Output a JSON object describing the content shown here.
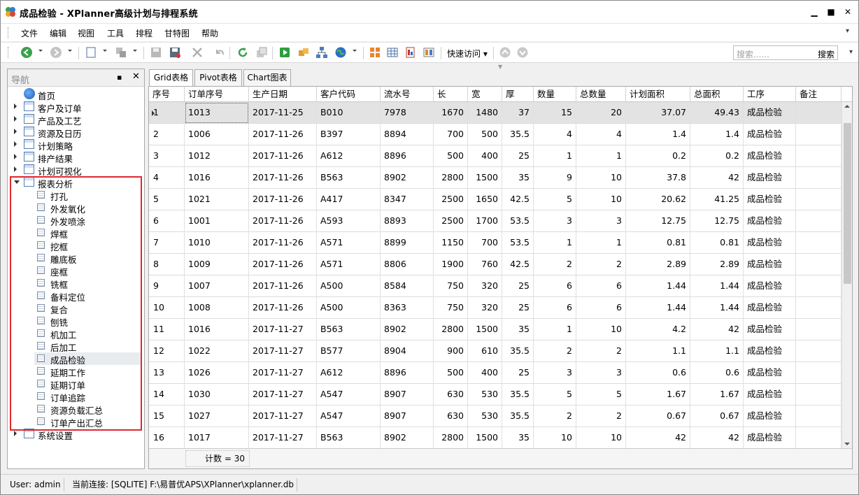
{
  "window": {
    "title": "成品检验 - XPlanner高级计划与排程系统",
    "minimize_glyph": "▁",
    "maximize_glyph": "■",
    "close_glyph": "✕"
  },
  "menu": [
    "文件",
    "编辑",
    "视图",
    "工具",
    "排程",
    "甘特图",
    "帮助"
  ],
  "toolbar": {
    "quick_access_label": "快速访问",
    "search_placeholder": "搜索......",
    "search_button": "搜索",
    "icons": [
      "back-icon",
      "forward-icon",
      "new-icon",
      "copy-icon",
      "save-icon",
      "save-all-icon",
      "delete-icon",
      "undo-icon",
      "refresh-icon",
      "window-icon",
      "run-icon",
      "boxes-icon",
      "org-chart-icon",
      "globe-icon",
      "layout-grid-icon",
      "table-icon",
      "report-icon",
      "columns-icon",
      "nav-up-icon",
      "nav-down-icon"
    ]
  },
  "nav": {
    "title": "导航",
    "pin_glyph": "▪",
    "close_glyph": "✕",
    "items": [
      {
        "label": "首页",
        "type": "home"
      },
      {
        "label": "客户及订单",
        "type": "folder"
      },
      {
        "label": "产品及工艺",
        "type": "folder"
      },
      {
        "label": "资源及日历",
        "type": "folder"
      },
      {
        "label": "计划策略",
        "type": "folder"
      },
      {
        "label": "排产结果",
        "type": "folder"
      },
      {
        "label": "计划可视化",
        "type": "folder"
      },
      {
        "label": "报表分析",
        "type": "folder-open"
      }
    ],
    "report_children": [
      "打孔",
      "外发氧化",
      "外发喷涂",
      "焊框",
      "挖框",
      "雕底板",
      "座框",
      "铣框",
      "备料定位",
      "复合",
      "刨铣",
      "机加工",
      "后加工",
      "成品检验",
      "延期工作",
      "延期订单",
      "订单追踪",
      "资源负载汇总",
      "订单产出汇总"
    ],
    "selected_child": "成品检验",
    "last_item": "系统设置",
    "highlight_color": "#e0282e"
  },
  "tabs": [
    "Grid表格",
    "Pivot表格",
    "Chart图表"
  ],
  "active_tab": "Grid表格",
  "grid": {
    "columns": [
      "序号",
      "订单序号",
      "生产日期",
      "客户代码",
      "流水号",
      "长",
      "宽",
      "厚",
      "数量",
      "总数量",
      "计划面积",
      "总面积",
      "工序",
      "备注"
    ],
    "rows": [
      [
        "1",
        "1013",
        "2017-11-25",
        "B010",
        "7978",
        "1670",
        "1480",
        "37",
        "15",
        "20",
        "37.07",
        "49.43",
        "成品检验",
        ""
      ],
      [
        "2",
        "1006",
        "2017-11-26",
        "B397",
        "8894",
        "700",
        "500",
        "35.5",
        "4",
        "4",
        "1.4",
        "1.4",
        "成品检验",
        ""
      ],
      [
        "3",
        "1012",
        "2017-11-26",
        "A612",
        "8896",
        "500",
        "400",
        "25",
        "1",
        "1",
        "0.2",
        "0.2",
        "成品检验",
        ""
      ],
      [
        "4",
        "1016",
        "2017-11-26",
        "B563",
        "8902",
        "2800",
        "1500",
        "35",
        "9",
        "10",
        "37.8",
        "42",
        "成品检验",
        ""
      ],
      [
        "5",
        "1021",
        "2017-11-26",
        "A417",
        "8347",
        "2500",
        "1650",
        "42.5",
        "5",
        "10",
        "20.62",
        "41.25",
        "成品检验",
        ""
      ],
      [
        "6",
        "1001",
        "2017-11-26",
        "A593",
        "8893",
        "2500",
        "1700",
        "53.5",
        "3",
        "3",
        "12.75",
        "12.75",
        "成品检验",
        ""
      ],
      [
        "7",
        "1010",
        "2017-11-26",
        "A571",
        "8899",
        "1150",
        "700",
        "53.5",
        "1",
        "1",
        "0.81",
        "0.81",
        "成品检验",
        ""
      ],
      [
        "8",
        "1009",
        "2017-11-26",
        "A571",
        "8806",
        "1900",
        "760",
        "42.5",
        "2",
        "2",
        "2.89",
        "2.89",
        "成品检验",
        ""
      ],
      [
        "9",
        "1007",
        "2017-11-26",
        "A500",
        "8584",
        "750",
        "320",
        "25",
        "6",
        "6",
        "1.44",
        "1.44",
        "成品检验",
        ""
      ],
      [
        "10",
        "1008",
        "2017-11-26",
        "A500",
        "8363",
        "750",
        "320",
        "25",
        "6",
        "6",
        "1.44",
        "1.44",
        "成品检验",
        ""
      ],
      [
        "11",
        "1016",
        "2017-11-27",
        "B563",
        "8902",
        "2800",
        "1500",
        "35",
        "1",
        "10",
        "4.2",
        "42",
        "成品检验",
        ""
      ],
      [
        "12",
        "1022",
        "2017-11-27",
        "B577",
        "8904",
        "900",
        "610",
        "35.5",
        "2",
        "2",
        "1.1",
        "1.1",
        "成品检验",
        ""
      ],
      [
        "13",
        "1026",
        "2017-11-27",
        "A612",
        "8896",
        "500",
        "400",
        "25",
        "3",
        "3",
        "0.6",
        "0.6",
        "成品检验",
        ""
      ],
      [
        "14",
        "1030",
        "2017-11-27",
        "A547",
        "8907",
        "630",
        "530",
        "35.5",
        "5",
        "5",
        "1.67",
        "1.67",
        "成品检验",
        ""
      ],
      [
        "15",
        "1027",
        "2017-11-27",
        "A547",
        "8907",
        "630",
        "530",
        "35.5",
        "2",
        "2",
        "0.67",
        "0.67",
        "成品检验",
        ""
      ],
      [
        "16",
        "1017",
        "2017-11-27",
        "B563",
        "8902",
        "2800",
        "1500",
        "35",
        "10",
        "10",
        "42",
        "42",
        "成品检验",
        ""
      ]
    ],
    "footer_count": "计数 = 30"
  },
  "status": {
    "user": "User: admin",
    "connection": "当前连接: [SQLITE] F:\\易普优APS\\XPlanner\\xplanner.db"
  }
}
